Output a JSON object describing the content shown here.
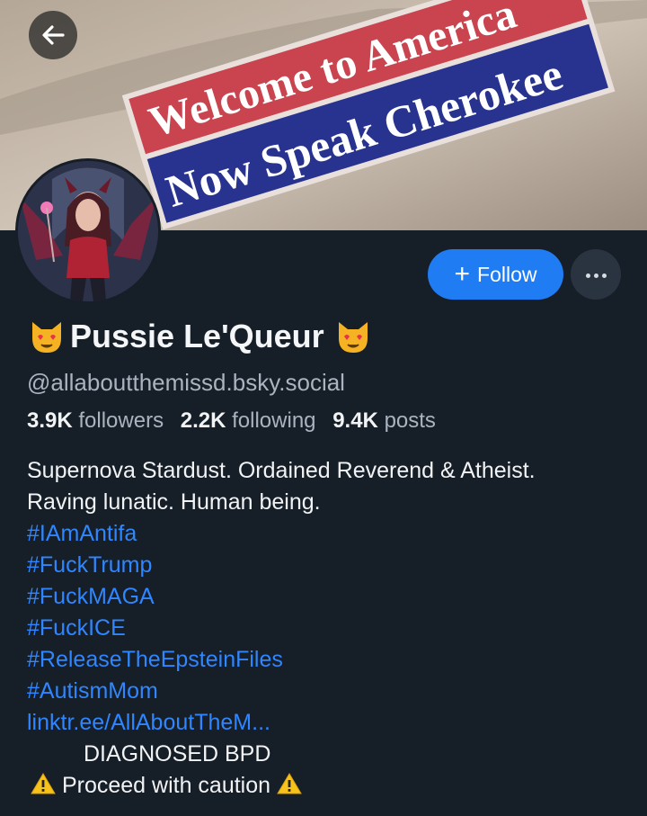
{
  "banner": {
    "sign_top": "Welcome to America",
    "sign_bottom": "Now Speak Cherokee"
  },
  "profile": {
    "display_name": "Pussie Le'Queur",
    "handle": "@allaboutthemissd.bsky.social",
    "follow_label": "Follow",
    "stats": {
      "followers_count": "3.9K",
      "followers_label": "followers",
      "following_count": "2.2K",
      "following_label": "following",
      "posts_count": "9.4K",
      "posts_label": "posts"
    },
    "bio": {
      "line1": "Supernova Stardust. Ordained Reverend & Atheist.",
      "line2": "Raving lunatic. Human being.",
      "tags": [
        "#IAmAntifa",
        "#FuckTrump",
        "#FuckMAGA",
        "#FuckICE",
        "#ReleaseTheEpsteinFiles",
        "#AutismMom"
      ],
      "link": "linktr.ee/AllAboutTheM...",
      "diagnosis": "DIAGNOSED BPD",
      "caution": "Proceed with caution"
    }
  },
  "icons": {
    "back": "arrow-left-icon",
    "follow": "plus-icon",
    "more": "ellipsis-icon",
    "name_emoji": "heart-eyes-cat-icon",
    "warning": "warning-icon"
  },
  "colors": {
    "background": "#161e27",
    "accent": "#1f7cf2",
    "link": "#2f86ff",
    "muted": "#aab4c0"
  }
}
